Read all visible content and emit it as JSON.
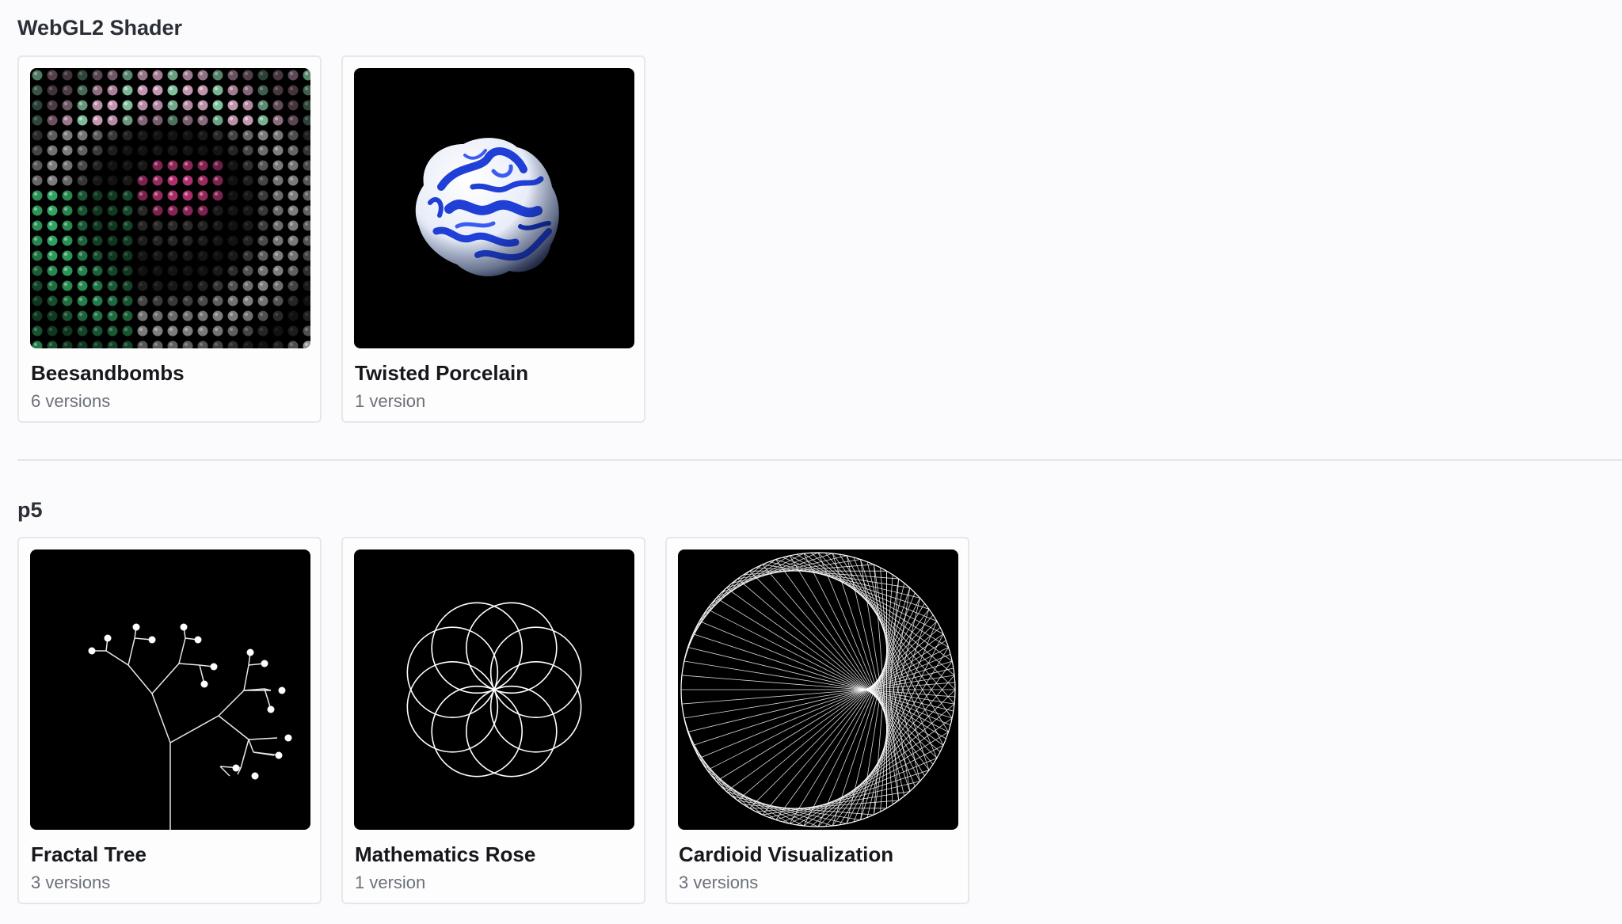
{
  "sections": [
    {
      "title": "WebGL2 Shader",
      "cards": [
        {
          "title": "Beesandbombs",
          "subtitle": "6 versions",
          "thumbnail": "dot-grid-shader-thumbnail"
        },
        {
          "title": "Twisted Porcelain",
          "subtitle": "1 version",
          "thumbnail": "blue-porcelain-stone-thumbnail"
        }
      ]
    },
    {
      "title": "p5",
      "cards": [
        {
          "title": "Fractal Tree",
          "subtitle": "3 versions",
          "thumbnail": "fractal-tree-thumbnail"
        },
        {
          "title": "Mathematics Rose",
          "subtitle": "1 version",
          "thumbnail": "rose-curve-thumbnail"
        },
        {
          "title": "Cardioid Visualization",
          "subtitle": "3 versions",
          "thumbnail": "cardioid-thumbnail"
        }
      ]
    }
  ],
  "colors": {
    "background": "#fbfbfd",
    "card_border": "#e6e7ea",
    "thumbnail_bg": "#000000",
    "porcelain_blue": "#1f3fd6",
    "dot_green": "#3ccf7a",
    "dot_pink": "#d63a86"
  }
}
